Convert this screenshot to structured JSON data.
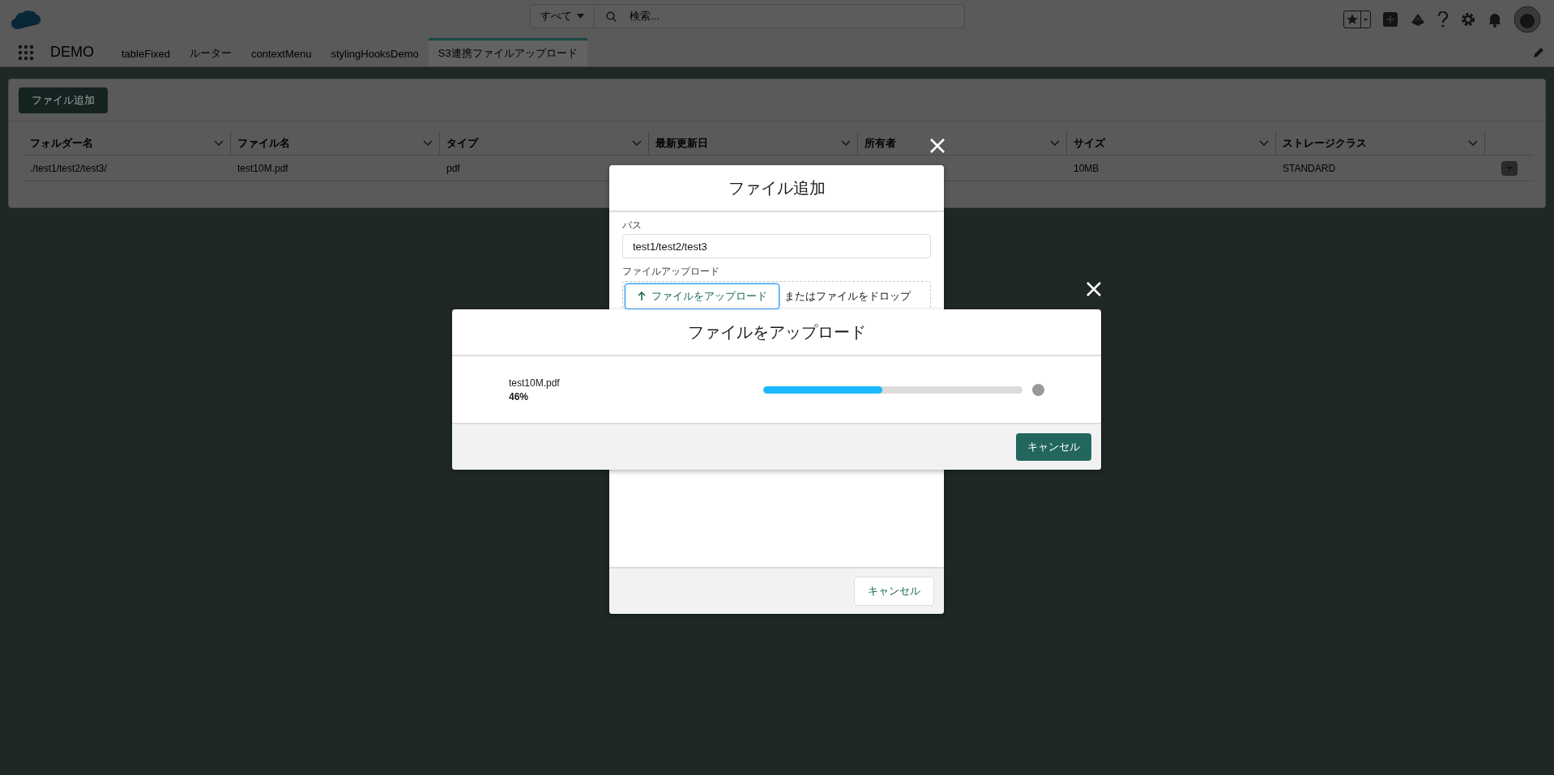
{
  "header": {
    "search_scope": "すべて",
    "search_placeholder": "検索..."
  },
  "nav": {
    "app_name": "DEMO",
    "tabs": [
      {
        "label": "tableFixed",
        "selected": false
      },
      {
        "label": "ルーター",
        "selected": false
      },
      {
        "label": "contextMenu",
        "selected": false
      },
      {
        "label": "stylingHooksDemo",
        "selected": false
      },
      {
        "label": "S3連携ファイルアップロード",
        "selected": true
      }
    ]
  },
  "toolbar": {
    "add_button": "ファイル追加"
  },
  "table": {
    "columns": [
      "フォルダー名",
      "ファイル名",
      "タイプ",
      "最新更新日",
      "所有者",
      "サイズ",
      "ストレージクラス"
    ],
    "rows": [
      {
        "folder": "./test1/test2/test3/",
        "file": "test10M.pdf",
        "type": "pdf",
        "size": "10MB",
        "storage_class": "STANDARD"
      }
    ]
  },
  "add_dialog": {
    "title": "ファイル追加",
    "path_label": "パス",
    "path_value": "test1/test2/test3",
    "upload_label": "ファイルアップロード",
    "upload_button": "ファイルをアップロード",
    "drop_hint": "またはファイルをドロップ",
    "cancel_button": "キャンセル"
  },
  "upload_dialog": {
    "title": "ファイルをアップロード",
    "file_name": "test10M.pdf",
    "percent": "46%",
    "level": 0.46,
    "cancel_button": "キャンセル"
  }
}
